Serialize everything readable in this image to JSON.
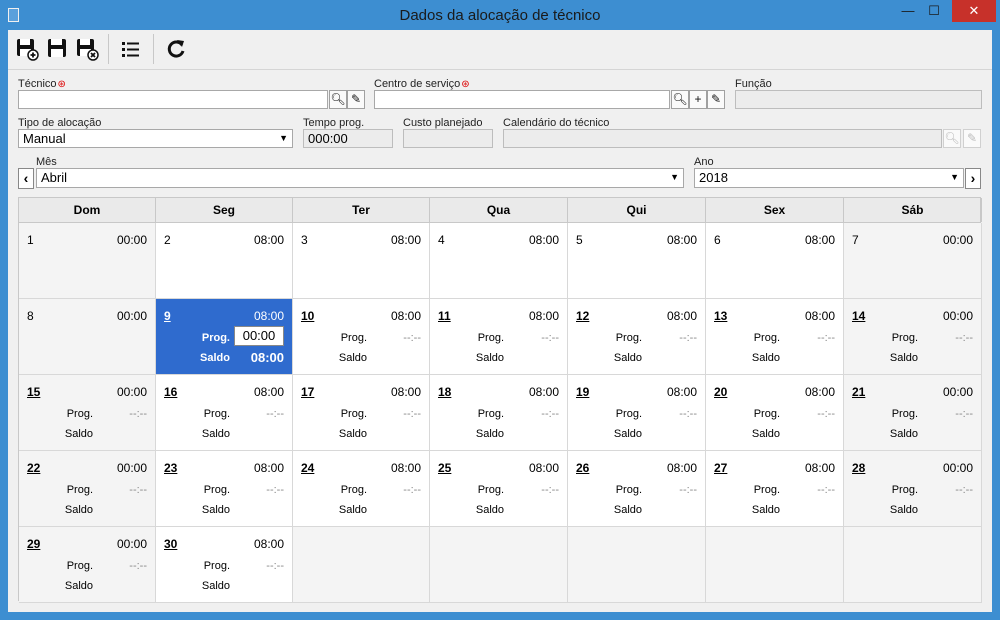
{
  "window": {
    "title": "Dados da alocação de técnico",
    "min": "—",
    "max": "☐",
    "close": "✕"
  },
  "toolbar": {
    "save_new_icon": "save-new-icon",
    "save_icon": "save-icon",
    "save_close_icon": "save-close-icon",
    "list_icon": "list-icon",
    "refresh_icon": "refresh-icon"
  },
  "form": {
    "tecnico": {
      "label": "Técnico",
      "value": ""
    },
    "centro_servico": {
      "label": "Centro de serviço",
      "value": ""
    },
    "funcao": {
      "label": "Função",
      "value": ""
    },
    "tipo_alocacao": {
      "label": "Tipo de alocação",
      "value": "Manual"
    },
    "tempo_prog": {
      "label": "Tempo prog.",
      "value": "000:00"
    },
    "custo_planejado": {
      "label": "Custo planejado",
      "value": ""
    },
    "calendario_tecnico": {
      "label": "Calendário do técnico",
      "value": ""
    },
    "mes": {
      "label": "Mês",
      "value": "Abril"
    },
    "ano": {
      "label": "Ano",
      "value": "2018"
    }
  },
  "calendar": {
    "weekdays": [
      "Dom",
      "Seg",
      "Ter",
      "Qua",
      "Qui",
      "Sex",
      "Sáb"
    ],
    "prog_label": "Prog.",
    "saldo_label": "Saldo",
    "empty_value": "--:--",
    "selected_prog": "00:00",
    "weeks": [
      [
        {
          "day": "1",
          "hours": "00:00",
          "link": false,
          "details": false
        },
        {
          "day": "2",
          "hours": "08:00",
          "link": false,
          "details": false
        },
        {
          "day": "3",
          "hours": "08:00",
          "link": false,
          "details": false
        },
        {
          "day": "4",
          "hours": "08:00",
          "link": false,
          "details": false
        },
        {
          "day": "5",
          "hours": "08:00",
          "link": false,
          "details": false
        },
        {
          "day": "6",
          "hours": "08:00",
          "link": false,
          "details": false
        },
        {
          "day": "7",
          "hours": "00:00",
          "link": false,
          "details": false
        }
      ],
      [
        {
          "day": "8",
          "hours": "00:00",
          "link": false,
          "details": false
        },
        {
          "day": "9",
          "hours": "08:00",
          "link": true,
          "details": true,
          "selected": true,
          "saldo": "08:00"
        },
        {
          "day": "10",
          "hours": "08:00",
          "link": true,
          "details": true
        },
        {
          "day": "11",
          "hours": "08:00",
          "link": true,
          "details": true
        },
        {
          "day": "12",
          "hours": "08:00",
          "link": true,
          "details": true
        },
        {
          "day": "13",
          "hours": "08:00",
          "link": true,
          "details": true
        },
        {
          "day": "14",
          "hours": "00:00",
          "link": true,
          "details": true
        }
      ],
      [
        {
          "day": "15",
          "hours": "00:00",
          "link": true,
          "details": true
        },
        {
          "day": "16",
          "hours": "08:00",
          "link": true,
          "details": true
        },
        {
          "day": "17",
          "hours": "08:00",
          "link": true,
          "details": true
        },
        {
          "day": "18",
          "hours": "08:00",
          "link": true,
          "details": true
        },
        {
          "day": "19",
          "hours": "08:00",
          "link": true,
          "details": true
        },
        {
          "day": "20",
          "hours": "08:00",
          "link": true,
          "details": true
        },
        {
          "day": "21",
          "hours": "00:00",
          "link": true,
          "details": true
        }
      ],
      [
        {
          "day": "22",
          "hours": "00:00",
          "link": true,
          "details": true
        },
        {
          "day": "23",
          "hours": "08:00",
          "link": true,
          "details": true
        },
        {
          "day": "24",
          "hours": "08:00",
          "link": true,
          "details": true
        },
        {
          "day": "25",
          "hours": "08:00",
          "link": true,
          "details": true
        },
        {
          "day": "26",
          "hours": "08:00",
          "link": true,
          "details": true
        },
        {
          "day": "27",
          "hours": "08:00",
          "link": true,
          "details": true
        },
        {
          "day": "28",
          "hours": "00:00",
          "link": true,
          "details": true
        }
      ],
      [
        {
          "day": "29",
          "hours": "00:00",
          "link": true,
          "details": true
        },
        {
          "day": "30",
          "hours": "08:00",
          "link": true,
          "details": true
        },
        null,
        null,
        null,
        null,
        null
      ]
    ]
  }
}
